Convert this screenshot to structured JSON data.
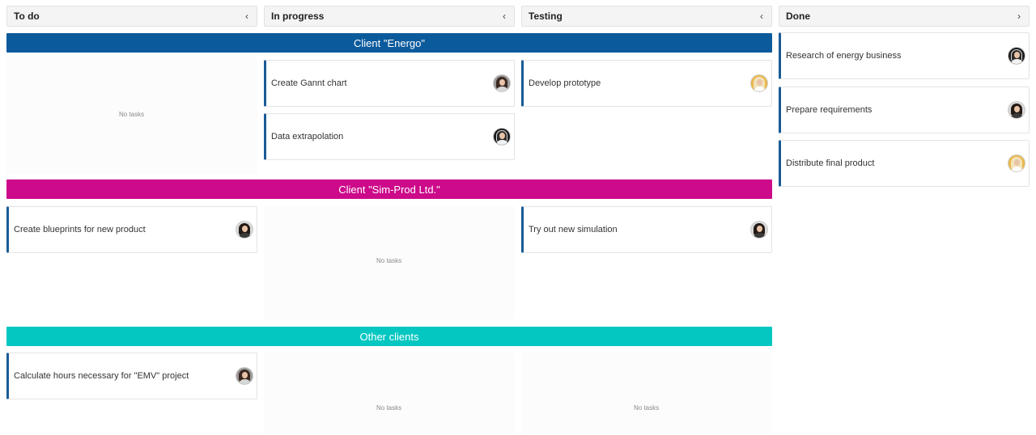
{
  "columns": [
    {
      "title": "To do",
      "chevron": "‹",
      "chevron_icon": "chevron-left-icon"
    },
    {
      "title": "In progress",
      "chevron": "‹",
      "chevron_icon": "chevron-left-icon"
    },
    {
      "title": "Testing",
      "chevron": "‹",
      "chevron_icon": "chevron-left-icon"
    },
    {
      "title": "Done",
      "chevron": "›",
      "chevron_icon": "chevron-right-icon"
    }
  ],
  "swimlanes": [
    {
      "title": "Client \"Energo\"",
      "color": "#0b5b9c"
    },
    {
      "title": "Client \"Sim-Prod Ltd.\"",
      "color": "#cc0a8a"
    },
    {
      "title": "Other clients",
      "color": "#05c7c1"
    }
  ],
  "cards": {
    "energo_inprogress_1": {
      "label": "Create Gannt chart",
      "avatar": "avatar-gray"
    },
    "energo_inprogress_2": {
      "label": "Data extrapolation",
      "avatar": "avatar-dark"
    },
    "energo_testing_1": {
      "label": "Develop prototype",
      "avatar": "avatar-gold"
    },
    "simprod_todo_1": {
      "label": "Create blueprints for new product",
      "avatar": "avatar-light"
    },
    "simprod_testing_1": {
      "label": "Try out new simulation",
      "avatar": "avatar-light"
    },
    "other_todo_1": {
      "label": "Calculate hours necessary for \"EMV\" project",
      "avatar": "avatar-gray"
    },
    "done_1": {
      "label": "Research of energy business",
      "avatar": "avatar-dark"
    },
    "done_2": {
      "label": "Prepare requirements",
      "avatar": "avatar-light"
    },
    "done_3": {
      "label": "Distribute final product",
      "avatar": "avatar-gold"
    }
  },
  "empty_text": "No tasks",
  "accent_color": "#1a5b96"
}
